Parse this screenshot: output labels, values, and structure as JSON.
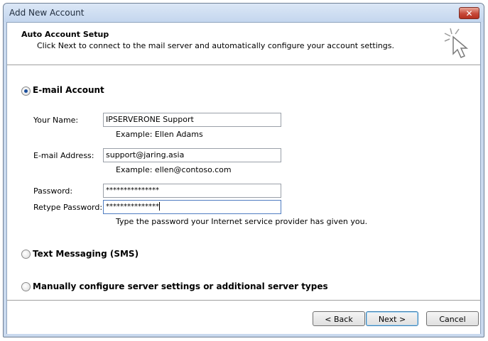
{
  "window": {
    "title": "Add New Account",
    "close_label": "✕"
  },
  "header": {
    "title": "Auto Account Setup",
    "subtitle": "Click Next to connect to the mail server and automatically configure your account settings."
  },
  "options": {
    "email": {
      "label": "E-mail Account",
      "selected": true
    },
    "sms": {
      "label": "Text Messaging (SMS)",
      "selected": false
    },
    "manual": {
      "label": "Manually configure server settings or additional server types",
      "selected": false
    }
  },
  "form": {
    "name": {
      "label": "Your Name:",
      "value": "IPSERVERONE Support",
      "hint": "Example: Ellen Adams"
    },
    "email": {
      "label": "E-mail Address:",
      "value": "support@jaring.asia",
      "hint": "Example: ellen@contoso.com"
    },
    "password": {
      "label": "Password:",
      "value": "***************"
    },
    "retype": {
      "label": "Retype Password:",
      "value": "***************"
    },
    "password_hint": "Type the password your Internet service provider has given you."
  },
  "buttons": {
    "back": "< Back",
    "next": "Next >",
    "cancel": "Cancel"
  },
  "icons": {
    "wizard": "cursor-sparkle-icon",
    "close": "close-icon"
  }
}
